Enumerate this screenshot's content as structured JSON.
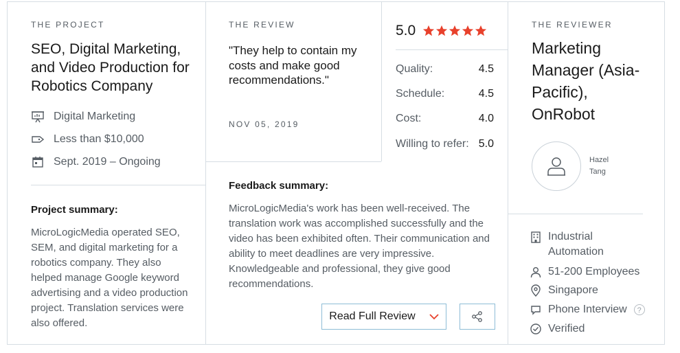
{
  "project": {
    "eyebrow": "THE PROJECT",
    "title": "SEO, Digital Marketing, and Video Production for Robotics Company",
    "meta": [
      {
        "icon": "presentation-icon",
        "text": "Digital Marketing"
      },
      {
        "icon": "price-tag-icon",
        "text": "Less than $10,000"
      },
      {
        "icon": "calendar-icon",
        "text": "Sept. 2019 – Ongoing"
      }
    ],
    "summary_label": "Project summary:",
    "summary_text": "MicroLogicMedia operated SEO, SEM, and digital marketing for a robotics company. They also helped manage Google keyword advertising and a video production project. Translation services were also offered."
  },
  "review": {
    "eyebrow": "THE REVIEW",
    "quote": "\"They help to contain my costs and make good recommendations.\"",
    "date": "NOV 05, 2019",
    "overall": "5.0",
    "stars": 5,
    "star_color": "#e8412c",
    "ratings": [
      {
        "label": "Quality:",
        "value": "4.5"
      },
      {
        "label": "Schedule:",
        "value": "4.5"
      },
      {
        "label": "Cost:",
        "value": "4.0"
      },
      {
        "label": "Willing to refer:",
        "value": "5.0"
      }
    ],
    "feedback_label": "Feedback summary:",
    "feedback_text": "MicroLogicMedia's work has been well-received. The translation work was accomplished successfully and the video has been exhibited often. Their communication and ability to meet deadlines are very impressive. Knowledgeable and professional, they give good recommendations.",
    "read_button": "Read Full Review",
    "accent_color": "#e8412c"
  },
  "reviewer": {
    "eyebrow": "THE REVIEWER",
    "title": "Marketing Manager (Asia-Pacific), OnRobot",
    "name_first": "Hazel",
    "name_last": "Tang",
    "info": [
      {
        "icon": "building-icon",
        "text": "Industrial Automation"
      },
      {
        "icon": "person-icon",
        "text": "51-200 Employees"
      },
      {
        "icon": "location-pin-icon",
        "text": "Singapore"
      },
      {
        "icon": "chat-bubble-icon",
        "text": "Phone Interview",
        "badge": "?"
      },
      {
        "icon": "check-circle-icon",
        "text": "Verified"
      }
    ]
  }
}
